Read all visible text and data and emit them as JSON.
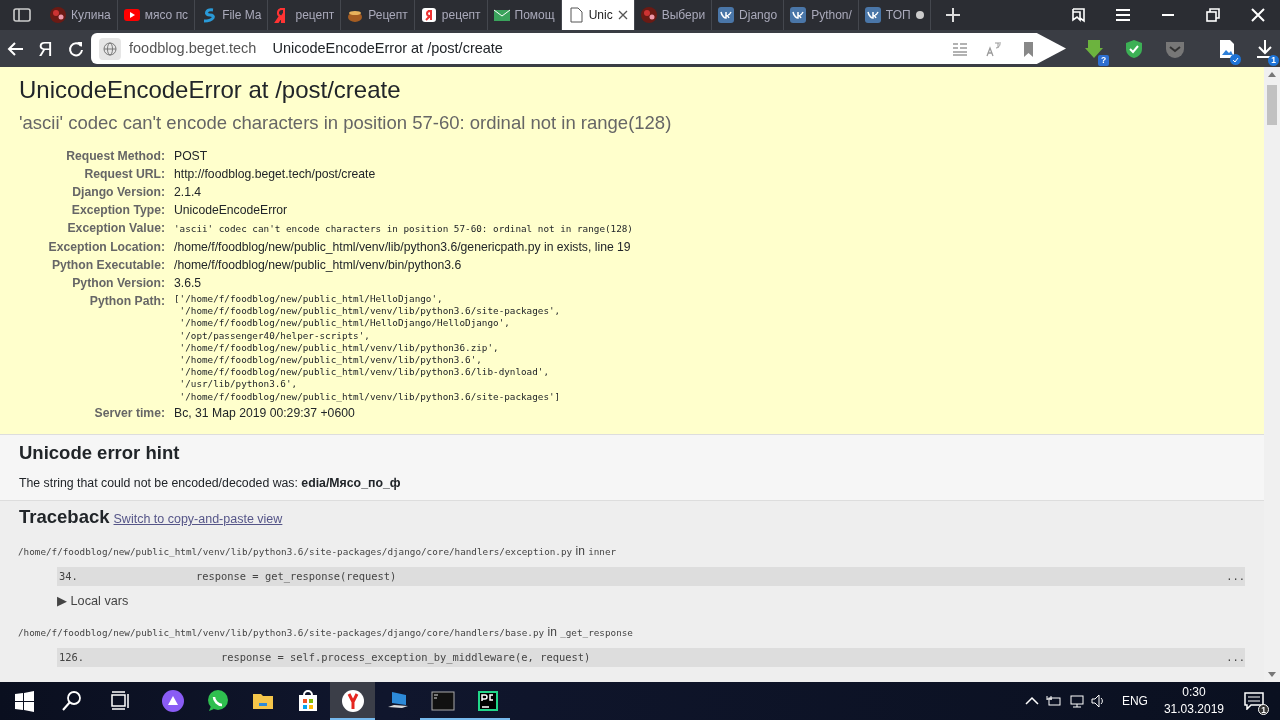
{
  "browser": {
    "tabs": [
      {
        "label": "Кулина",
        "kind": "photo",
        "selected": false
      },
      {
        "label": "мясо пс",
        "kind": "video",
        "selected": false
      },
      {
        "label": "File Ma",
        "kind": "swirl",
        "selected": false
      },
      {
        "label": "рецепт",
        "kind": "ya",
        "selected": false
      },
      {
        "label": "Рецепт",
        "kind": "pot",
        "selected": false
      },
      {
        "label": "рецепт",
        "kind": "ya-box",
        "selected": false
      },
      {
        "label": "Помощ",
        "kind": "mail",
        "selected": false
      },
      {
        "label": "Unic",
        "kind": "page",
        "selected": true
      },
      {
        "label": "Выбери",
        "kind": "photo",
        "selected": false
      },
      {
        "label": "Django",
        "kind": "vk",
        "selected": false
      },
      {
        "label": "Python/",
        "kind": "vk",
        "selected": false
      },
      {
        "label": "ТОП",
        "kind": "vk",
        "selected": false,
        "unsaved": true
      }
    ],
    "home_button": "Я",
    "address": {
      "domain": "foodblog.beget.tech",
      "title": "UnicodeEncodeError at /post/create"
    },
    "extension_badge": "?",
    "download_badge": "1"
  },
  "summary": {
    "title": "UnicodeEncodeError at /post/create",
    "subtitle": "'ascii' codec can't encode characters in position 57-60: ordinal not in range(128)",
    "meta": [
      {
        "label": "Request Method:",
        "kind": "text",
        "value": "POST"
      },
      {
        "label": "Request URL:",
        "kind": "text",
        "value": "http://foodblog.beget.tech/post/create"
      },
      {
        "label": "Django Version:",
        "kind": "text",
        "value": "2.1.4"
      },
      {
        "label": "Exception Type:",
        "kind": "text",
        "value": "UnicodeEncodeError"
      },
      {
        "label": "Exception Value:",
        "kind": "mono",
        "value": "'ascii' codec can't encode characters in position 57-60: ordinal not in range(128)"
      },
      {
        "label": "Exception Location:",
        "kind": "text",
        "value": "/home/f/foodblog/new/public_html/venv/lib/python3.6/genericpath.py in exists, line 19"
      },
      {
        "label": "Python Executable:",
        "kind": "text",
        "value": "/home/f/foodblog/new/public_html/venv/bin/python3.6"
      },
      {
        "label": "Python Version:",
        "kind": "text",
        "value": "3.6.5"
      },
      {
        "label": "Python Path:",
        "kind": "mono-lines",
        "lines": [
          "['/home/f/foodblog/new/public_html/HelloDjango',",
          " '/home/f/foodblog/new/public_html/venv/lib/python3.6/site-packages',",
          " '/home/f/foodblog/new/public_html/HelloDjango/HelloDjango',",
          " '/opt/passenger40/helper-scripts',",
          " '/home/f/foodblog/new/public_html/venv/lib/python36.zip',",
          " '/home/f/foodblog/new/public_html/venv/lib/python3.6',",
          " '/home/f/foodblog/new/public_html/venv/lib/python3.6/lib-dynload',",
          " '/usr/lib/python3.6',",
          " '/home/f/foodblog/new/public_html/venv/lib/python3.6/site-packages']"
        ]
      },
      {
        "label": "Server time:",
        "kind": "text",
        "value": "Вс, 31 Мар 2019 00:29:37 +0600"
      }
    ]
  },
  "hint": {
    "title": "Unicode error hint",
    "text": "The string that could not be encoded/decoded was: **edia/Мясо_по_ф**"
  },
  "traceback": {
    "title": "Traceback",
    "link": "Switch to copy-and-paste view",
    "frames": [
      {
        "file": "/home/f/foodblog/new/public_html/venv/lib/python3.6/site-packages/django/core/handlers/exception.py",
        "in": "in",
        "function": "inner",
        "line_no": "34.",
        "code": "            response = get_response(request)",
        "more": "...",
        "vars": "▶ Local vars"
      },
      {
        "file": "/home/f/foodblog/new/public_html/venv/lib/python3.6/site-packages/django/core/handlers/base.py",
        "in": "in",
        "function": "_get_response",
        "line_no": "126.",
        "code": "                response = self.process_exception_by_middleware(e, request)",
        "more": "..."
      }
    ]
  },
  "taskbar": {
    "apps": [
      {
        "kind": "alice",
        "selected": false,
        "running": false
      },
      {
        "kind": "whatsapp",
        "selected": false,
        "running": false
      },
      {
        "kind": "folder",
        "selected": false,
        "running": false
      },
      {
        "kind": "store",
        "selected": false,
        "running": false
      },
      {
        "kind": "yandex",
        "selected": true,
        "running": true
      },
      {
        "kind": "computer",
        "selected": false,
        "running": false
      },
      {
        "kind": "terminal",
        "selected": false,
        "running": true
      },
      {
        "kind": "pycharm",
        "selected": false,
        "running": true
      }
    ],
    "language": "ENG",
    "time": "0:30",
    "date": "31.03.2019",
    "notifications": "1"
  }
}
